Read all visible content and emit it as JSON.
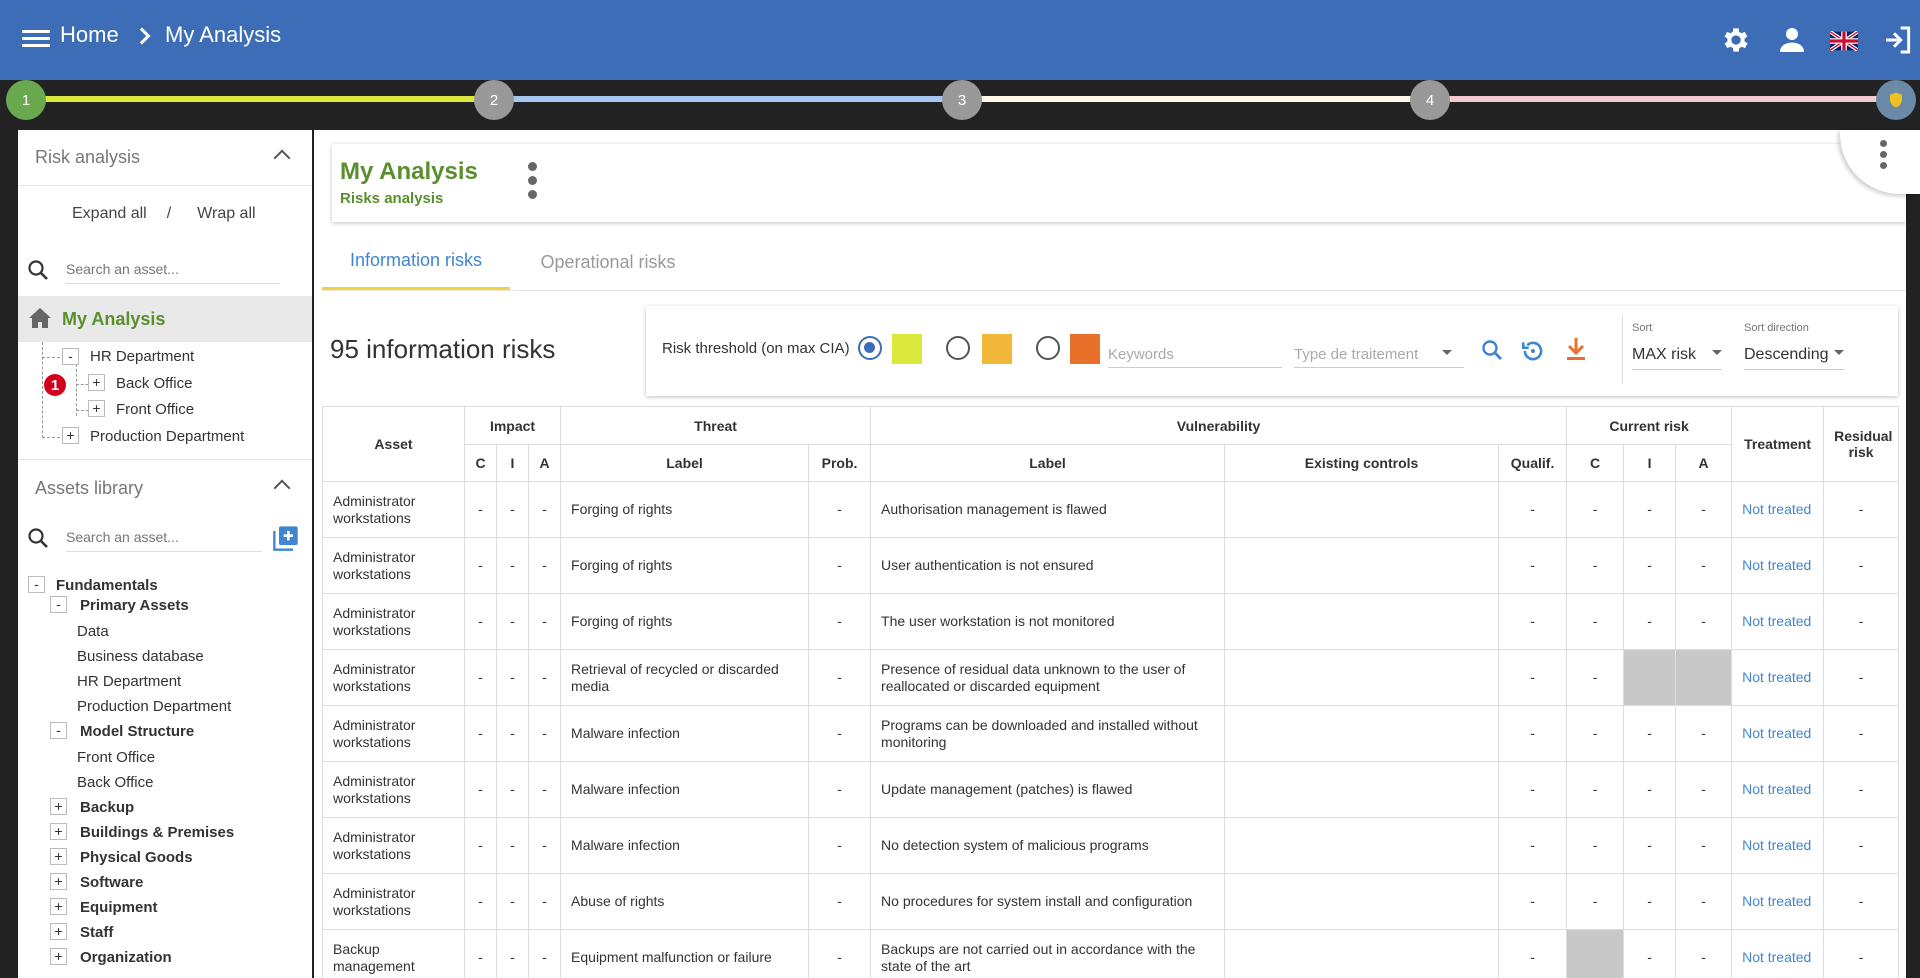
{
  "header": {
    "home": "Home",
    "current": "My Analysis",
    "flag_label": "EN"
  },
  "stepper": {
    "steps": [
      "1",
      "2",
      "3",
      "4"
    ],
    "colors": [
      "#d9e83b",
      "#a6c8f0",
      "#fff8e6",
      "#f5c9d0"
    ]
  },
  "sidebar": {
    "risk_title": "Risk analysis",
    "expand_all": "Expand all",
    "separator": "/",
    "wrap_all": "Wrap all",
    "search_placeholder": "Search an asset...",
    "root": "My Analysis",
    "badge": "1",
    "tree": [
      "HR Department",
      "Back Office",
      "Front Office",
      "Production Department"
    ],
    "library_title": "Assets library",
    "library_search": "Search an asset...",
    "library": {
      "fundamentals": "Fundamentals",
      "primary": "Primary Assets",
      "primary_items": [
        "Data",
        "Business database",
        "HR Department",
        "Production Department"
      ],
      "model": "Model Structure",
      "model_items": [
        "Front Office",
        "Back Office"
      ],
      "groups": [
        "Backup",
        "Buildings & Premises",
        "Physical Goods",
        "Software",
        "Equipment",
        "Staff",
        "Organization"
      ]
    }
  },
  "main": {
    "title": "My Analysis",
    "subtitle": "Risks analysis",
    "tab_info": "Information risks",
    "tab_oper": "Operational risks",
    "count": "95 information risks",
    "threshold_label": "Risk threshold (on max CIA)",
    "keywords_placeholder": "Keywords",
    "treatment_type": "Type de traitement",
    "sort_label": "Sort",
    "sort_value": "MAX risk",
    "sort_dir_label": "Sort direction",
    "sort_dir_value": "Descending",
    "swatch_colors": [
      "#d9e83b",
      "#f0b73a",
      "#e8702a"
    ]
  },
  "table": {
    "h_asset": "Asset",
    "h_impact": "Impact",
    "h_threat": "Threat",
    "h_vuln": "Vulnerability",
    "h_current": "Current risk",
    "h_treatment": "Treatment",
    "h_residual": "Residual risk",
    "h_c": "C",
    "h_i": "I",
    "h_a": "A",
    "h_label": "Label",
    "h_prob": "Prob.",
    "h_vlabel": "Label",
    "h_controls": "Existing controls",
    "h_qualif": "Qualif.",
    "h_cc": "C",
    "h_ci": "I",
    "h_ca": "A",
    "rows": [
      {
        "asset": "Administrator workstations",
        "threat": "Forging of rights",
        "vuln": "Authorisation management is flawed",
        "treat": "Not treated",
        "grey": []
      },
      {
        "asset": "Administrator workstations",
        "threat": "Forging of rights",
        "vuln": "User authentication is not ensured",
        "treat": "Not treated",
        "grey": []
      },
      {
        "asset": "Administrator workstations",
        "threat": "Forging of rights",
        "vuln": "The user workstation is not monitored",
        "treat": "Not treated",
        "grey": []
      },
      {
        "asset": "Administrator workstations",
        "threat": "Retrieval of recycled or discarded media",
        "vuln": "Presence of residual data unknown to the user of reallocated or discarded equipment",
        "treat": "Not treated",
        "grey": [
          "i",
          "a"
        ]
      },
      {
        "asset": "Administrator workstations",
        "threat": "Malware infection",
        "vuln": "Programs can be downloaded and installed without monitoring",
        "treat": "Not treated",
        "grey": []
      },
      {
        "asset": "Administrator workstations",
        "threat": "Malware infection",
        "vuln": "Update management (patches) is flawed",
        "treat": "Not treated",
        "grey": []
      },
      {
        "asset": "Administrator workstations",
        "threat": "Malware infection",
        "vuln": "No detection system of malicious programs",
        "treat": "Not treated",
        "grey": []
      },
      {
        "asset": "Administrator workstations",
        "threat": "Abuse of rights",
        "vuln": "No procedures for system install and configuration",
        "treat": "Not treated",
        "grey": []
      },
      {
        "asset": "Backup management",
        "threat": "Equipment malfunction or failure",
        "vuln": "Backups are not carried out in accordance with the state of the art",
        "treat": "Not treated",
        "grey": [
          "c"
        ]
      }
    ],
    "dash": "-"
  }
}
